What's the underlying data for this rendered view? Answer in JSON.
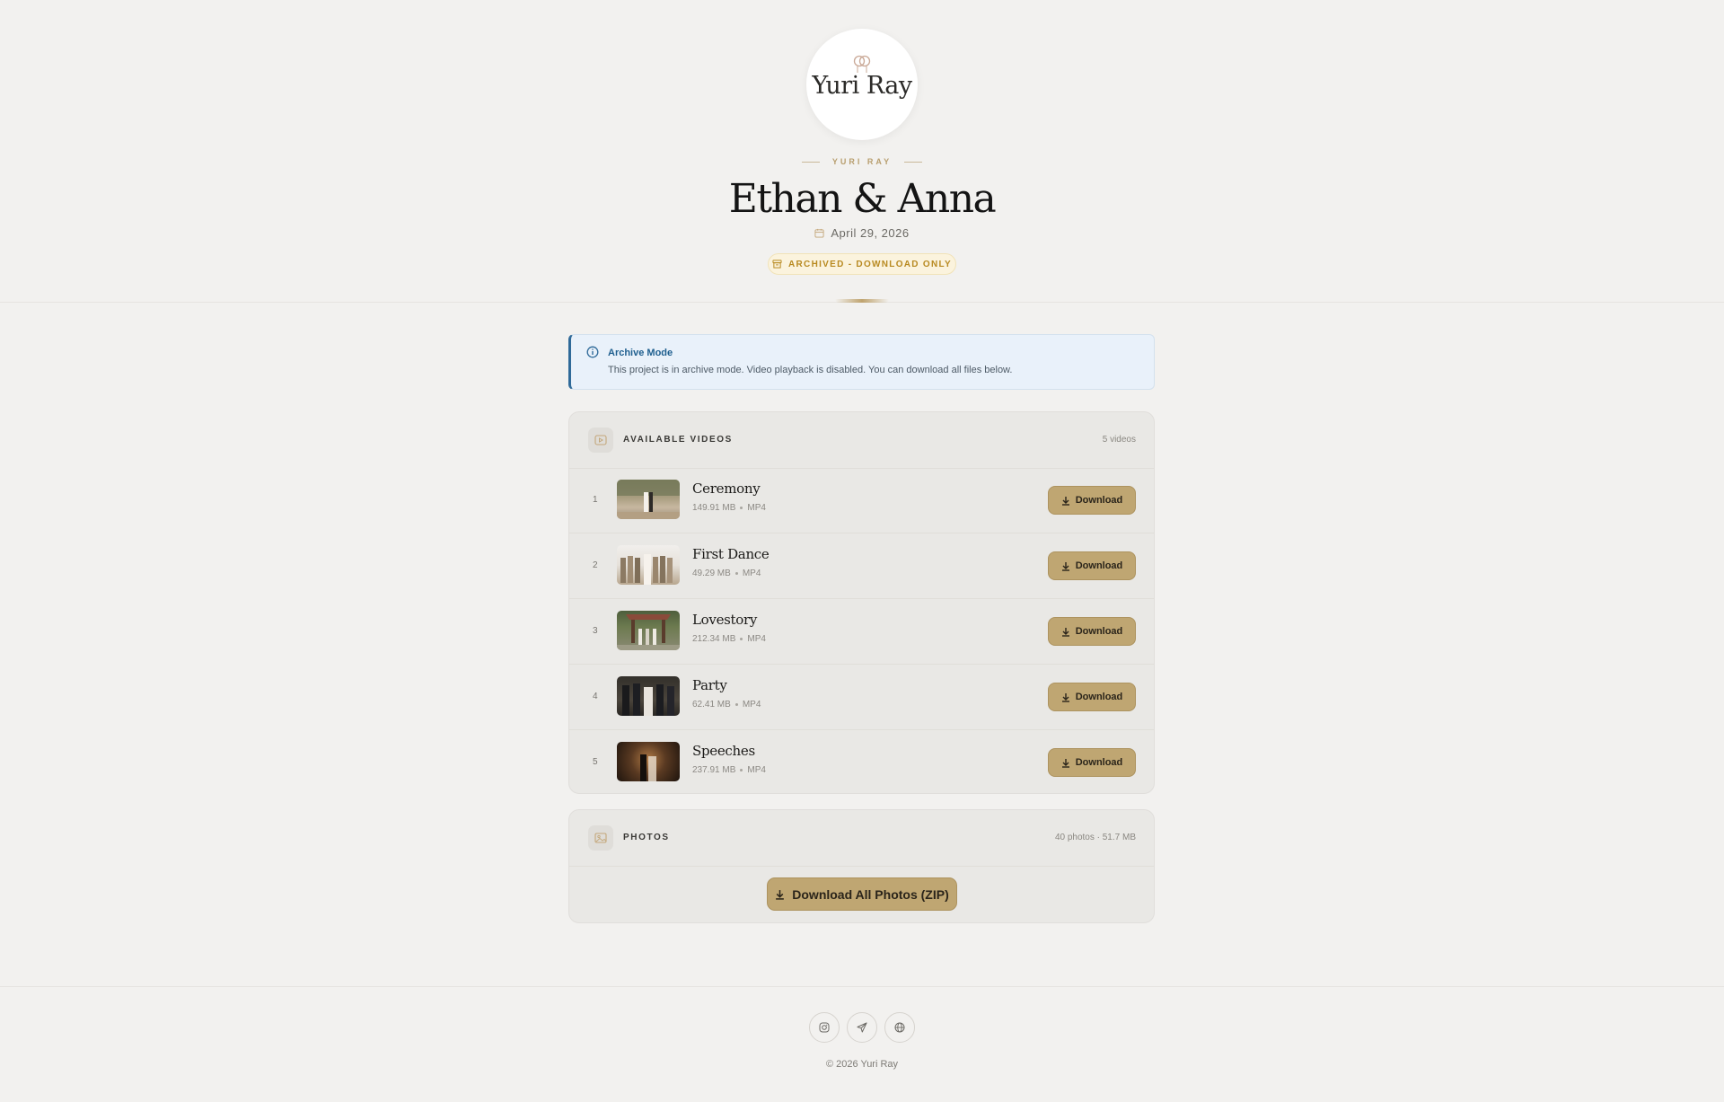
{
  "header": {
    "logo_text": "Yuri Ray",
    "brand": "YURI RAY",
    "title": "Ethan & Anna",
    "date": "April 29, 2026",
    "status_badge": "ARCHIVED - DOWNLOAD ONLY"
  },
  "notice": {
    "title": "Archive Mode",
    "text": "This project is in archive mode. Video playback is disabled. You can download all files below."
  },
  "videos": {
    "heading": "AVAILABLE VIDEOS",
    "count": "5 videos",
    "download_label": "Download",
    "items": [
      {
        "index": "1",
        "title": "Ceremony",
        "size": "149.91 MB",
        "format": "MP4"
      },
      {
        "index": "2",
        "title": "First Dance",
        "size": "49.29 MB",
        "format": "MP4"
      },
      {
        "index": "3",
        "title": "Lovestory",
        "size": "212.34 MB",
        "format": "MP4"
      },
      {
        "index": "4",
        "title": "Party",
        "size": "62.41 MB",
        "format": "MP4"
      },
      {
        "index": "5",
        "title": "Speeches",
        "size": "237.91 MB",
        "format": "MP4"
      }
    ]
  },
  "photos": {
    "heading": "PHOTOS",
    "summary": "40 photos · 51.7 MB",
    "zip_button": "Download All Photos (ZIP)"
  },
  "footer": {
    "social": [
      "instagram-icon",
      "telegram-icon",
      "globe-icon"
    ],
    "copyright": "© 2026 Yuri Ray"
  },
  "colors": {
    "accent": "#bfa672",
    "background": "#f2f1ef",
    "notice_blue": "#2f6a99",
    "badge_gold": "#b88a21"
  }
}
